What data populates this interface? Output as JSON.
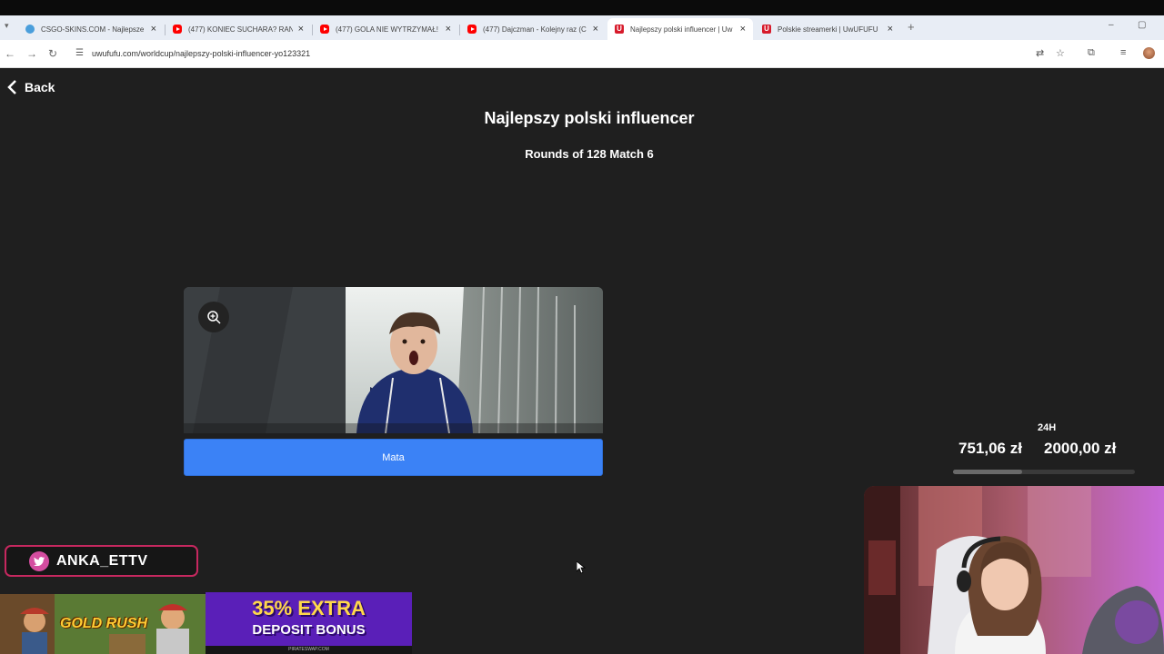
{
  "browser": {
    "tabs": [
      {
        "title": "CSGO-SKINS.COM - Najlepsze",
        "icon": "csgo-favicon"
      },
      {
        "title": "(477) KONIEC SUCHARA? RAND",
        "icon": "youtube-icon"
      },
      {
        "title": "(477) GOLA NIE WYTRZYMAŁ!",
        "icon": "youtube-icon"
      },
      {
        "title": "(477) Dajczman - Kolejny raz (C",
        "icon": "youtube-icon"
      },
      {
        "title": "Najlepszy polski influencer | Uw",
        "icon": "uwufufu-favicon"
      },
      {
        "title": "Polskie streamerki | UwUFUFU",
        "icon": "uwufufu-favicon"
      }
    ],
    "url": "uwufufu.com/worldcup/najlepszy-polski-influencer-yo123321"
  },
  "page": {
    "back_label": "Back",
    "title": "Najlepszy polski influencer",
    "round_info": "Rounds of 128 Match 6",
    "choice_label": "Mata"
  },
  "overlay": {
    "donation": {
      "period": "24H",
      "current": "751,06 zł",
      "goal": "2000,00 zł",
      "progress_fraction": 0.38
    },
    "handle": "ANKA_ETTV",
    "ad_left_text": "GOLD RUSH",
    "ad_right_line1": "35% EXTRA",
    "ad_right_line2": "DEPOSIT BONUS",
    "ad_right_footer": "PIRATESWAP.COM"
  },
  "colors": {
    "accent_blue": "#3b82f6",
    "page_bg": "#1f1f1f",
    "handle_border": "#c6285f"
  }
}
